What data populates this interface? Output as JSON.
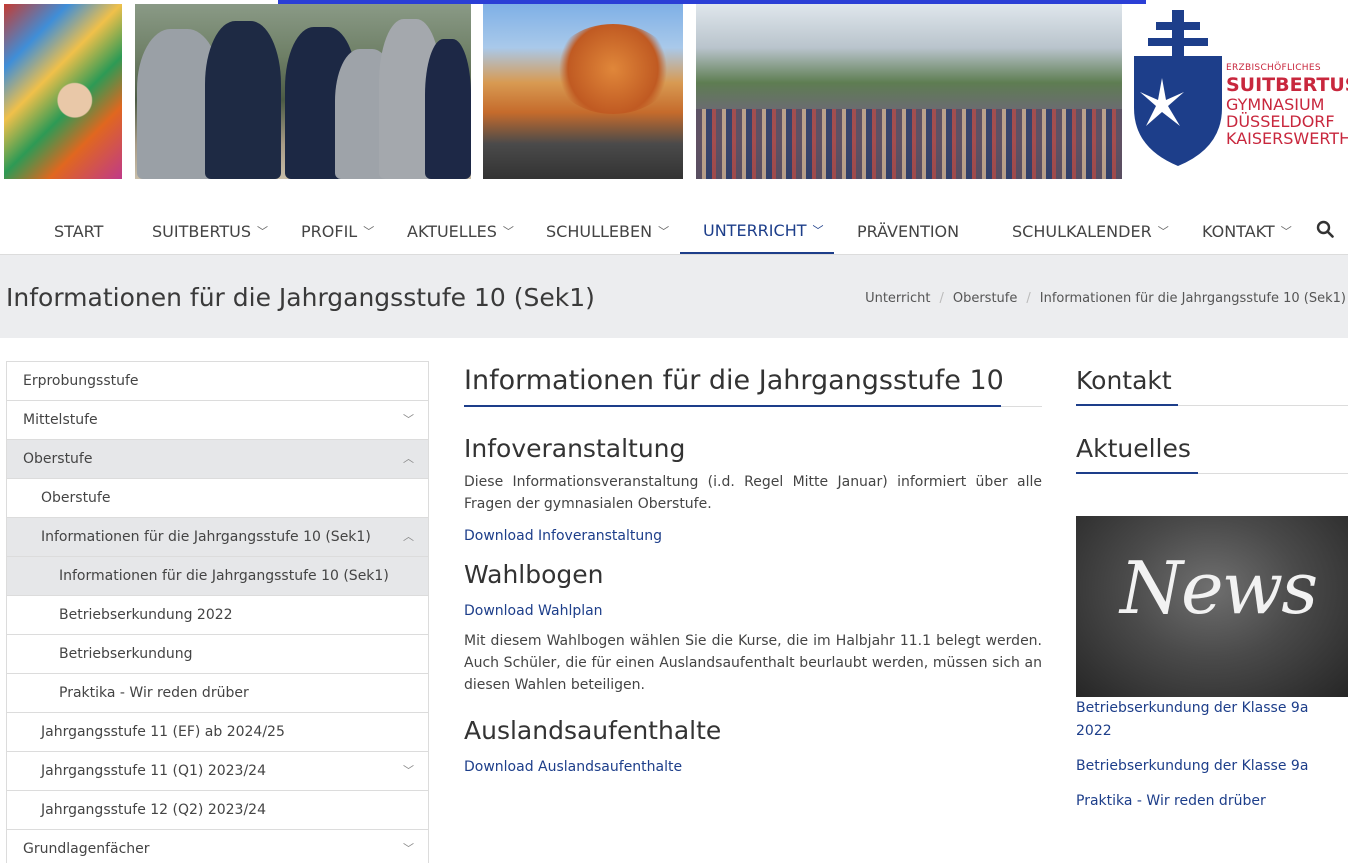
{
  "logo": {
    "line1": "ERZBISCHÖFLICHES",
    "line2": "SUITBERTUS",
    "line3": "GYMNASIUM",
    "line4": "DÜSSELDORF",
    "line5": "KAISERSWERTH"
  },
  "nav": {
    "items": [
      {
        "label": "START",
        "dropdown": false
      },
      {
        "label": "SUITBERTUS",
        "dropdown": true
      },
      {
        "label": "PROFIL",
        "dropdown": true
      },
      {
        "label": "AKTUELLES",
        "dropdown": true
      },
      {
        "label": "SCHULLEBEN",
        "dropdown": true
      },
      {
        "label": "UNTERRICHT",
        "dropdown": true,
        "active": true
      },
      {
        "label": "PRÄVENTION",
        "dropdown": false
      },
      {
        "label": "SCHULKALENDER",
        "dropdown": true
      },
      {
        "label": "KONTAKT",
        "dropdown": true
      }
    ],
    "search_icon": "search-icon"
  },
  "page": {
    "title": "Informationen für die Jahrgangsstufe 10 (Sek1)",
    "breadcrumb": [
      "Unterricht",
      "Oberstufe",
      "Informationen für die Jahrgangsstufe 10 (Sek1)"
    ]
  },
  "sidebar": {
    "items": [
      {
        "label": "Erprobungsstufe",
        "chevron": ""
      },
      {
        "label": "Mittelstufe",
        "chevron": "⌄"
      },
      {
        "label": "Oberstufe",
        "chevron": "⌃"
      },
      {
        "label": "Oberstufe",
        "chevron": ""
      },
      {
        "label": "Informationen für die Jahrgangsstufe 10 (Sek1)",
        "chevron": "⌃"
      },
      {
        "label": "Informationen für die Jahrgangsstufe 10 (Sek1)",
        "chevron": ""
      },
      {
        "label": "Betriebserkundung 2022",
        "chevron": ""
      },
      {
        "label": "Betriebserkundung",
        "chevron": ""
      },
      {
        "label": "Praktika - Wir reden drüber",
        "chevron": ""
      },
      {
        "label": "Jahrgangsstufe 11 (EF) ab 2024/25",
        "chevron": ""
      },
      {
        "label": "Jahrgangsstufe 11 (Q1) 2023/24",
        "chevron": "⌄"
      },
      {
        "label": "Jahrgangsstufe 12 (Q2) 2023/24",
        "chevron": ""
      },
      {
        "label": "Grundlagenfächer",
        "chevron": "⌄"
      }
    ]
  },
  "main": {
    "heading": "Informationen für die Jahrgangsstufe 10",
    "sections": [
      {
        "heading": "Infoveranstaltung",
        "text": "Diese Informationsveranstaltung (i.d. Regel Mitte Januar) informiert über alle Fragen der gymnasialen Oberstufe.",
        "link": "Download Infoveranstaltung"
      },
      {
        "heading": "Wahlbogen",
        "link": "Download Wahlplan",
        "text": "Mit diesem Wahlbogen wählen Sie die Kurse, die im Halbjahr 11.1 belegt werden. Auch Schüler, die für einen Auslandsaufenthalt beurlaubt werden, müssen sich an diesen Wahlen beteiligen."
      },
      {
        "heading": "Auslandsaufenthalte",
        "link": "Download Auslandsaufenthalte"
      }
    ]
  },
  "right": {
    "contact_heading": "Kontakt",
    "news_heading": "Aktuelles",
    "news_image_text": "News",
    "news_links": [
      "Betriebserkundung der Klasse 9a 2022",
      "Betriebserkundung der Klasse 9a",
      "Praktika - Wir reden drüber"
    ]
  },
  "colors": {
    "accent": "#1d3e8a",
    "logo_red": "#c8273d",
    "band": "#ecedef"
  }
}
